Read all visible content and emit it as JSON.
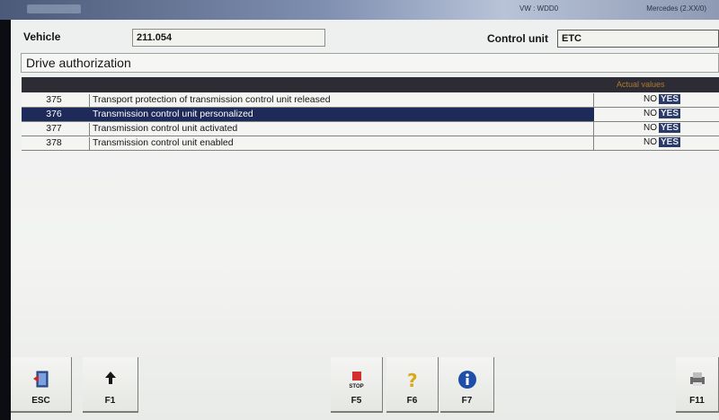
{
  "window": {
    "title_right": "VW : WDD0",
    "title_far": "Mercedes (2.XX/0)"
  },
  "header": {
    "vehicle_label": "Vehicle",
    "vehicle_value": "211.054",
    "control_unit_label": "Control unit",
    "control_unit_value": "ETC"
  },
  "section": {
    "title": "Drive authorization"
  },
  "table": {
    "value_header": "Actual values",
    "rows": [
      {
        "num": "375",
        "desc": "Transport protection of transmission control unit released",
        "no": "NO",
        "yes": "YES",
        "selected": false
      },
      {
        "num": "376",
        "desc": "Transmission control unit personalized",
        "no": "NO",
        "yes": "YES",
        "selected": true
      },
      {
        "num": "377",
        "desc": "Transmission control unit activated",
        "no": "NO",
        "yes": "YES",
        "selected": false
      },
      {
        "num": "378",
        "desc": "Transmission control unit enabled",
        "no": "NO",
        "yes": "YES",
        "selected": false
      }
    ]
  },
  "fkeys": {
    "esc": "ESC",
    "f1": "F1",
    "f5": "F5",
    "f5_stop": "STOP",
    "f6": "F6",
    "f7": "F7",
    "f11": "F11"
  },
  "colors": {
    "selected_row": "#1d2a5a",
    "table_header": "#2d2c34",
    "yes_highlight": "#2a3a66"
  }
}
